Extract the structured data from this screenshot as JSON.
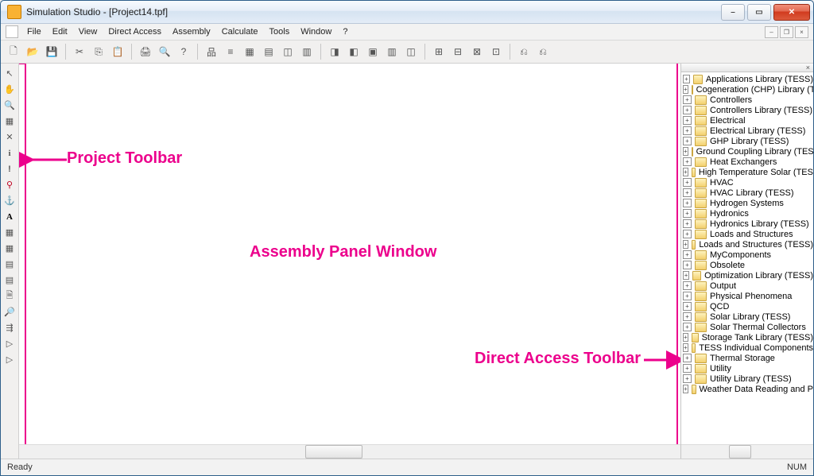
{
  "title": "Simulation Studio - [Project14.tpf]",
  "menu": {
    "file": "File",
    "edit": "Edit",
    "view": "View",
    "direct": "Direct Access",
    "assembly": "Assembly",
    "calculate": "Calculate",
    "tools": "Tools",
    "window": "Window",
    "help": "?"
  },
  "tb_icons": {
    "new": "🗋",
    "open": "📂",
    "save": "💾",
    "cut": "✂",
    "copy": "⎘",
    "paste": "📋",
    "print": "🖨",
    "preview": "🔍",
    "help": "?",
    "tree": "品",
    "list": "≡",
    "grid": "▦",
    "ruler": "▤",
    "a1": "◫",
    "a2": "▥",
    "a3": "◨",
    "a4": "◧",
    "a5": "▣",
    "a6": "▥",
    "a7": "◫",
    "b1": "⊞",
    "b2": "⊟",
    "b3": "⊠",
    "b4": "⊡",
    "c1": "⎌",
    "c2": "⎌"
  },
  "vt_icons": {
    "select": "↖",
    "hand": "✋",
    "zoom": "🔍",
    "grid": "▦",
    "del": "✕",
    "info": "i",
    "excl": "!",
    "key": "⚲",
    "anchor": "⚓",
    "text": "A",
    "d1": "▦",
    "d2": "▦",
    "d3": "▤",
    "d4": "▤",
    "doc": "🗎",
    "search": "🔎",
    "walk": "⇶",
    "go": "▷",
    "run": "▷"
  },
  "side": {
    "items": [
      "Applications Library (TESS)",
      "Cogeneration (CHP) Library (T",
      "Controllers",
      "Controllers Library (TESS)",
      "Electrical",
      "Electrical Library (TESS)",
      "GHP Library (TESS)",
      "Ground Coupling Library (TES",
      "Heat Exchangers",
      "High Temperature Solar (TES",
      "HVAC",
      "HVAC Library (TESS)",
      "Hydrogen Systems",
      "Hydronics",
      "Hydronics Library (TESS)",
      "Loads and Structures",
      "Loads and Structures (TESS)",
      "MyComponents",
      "Obsolete",
      "Optimization Library (TESS)",
      "Output",
      "Physical Phenomena",
      "QCD",
      "Solar Library (TESS)",
      "Solar Thermal Collectors",
      "Storage Tank Library (TESS)",
      "TESS Individual Components",
      "Thermal Storage",
      "Utility",
      "Utility Library (TESS)",
      "Weather Data Reading and P"
    ],
    "close_x": "×"
  },
  "status": {
    "ready": "Ready",
    "num": "NUM"
  },
  "annotations": {
    "assembly": "Assembly Panel Window",
    "project": "Project Toolbar",
    "direct": "Direct Access Toolbar"
  }
}
